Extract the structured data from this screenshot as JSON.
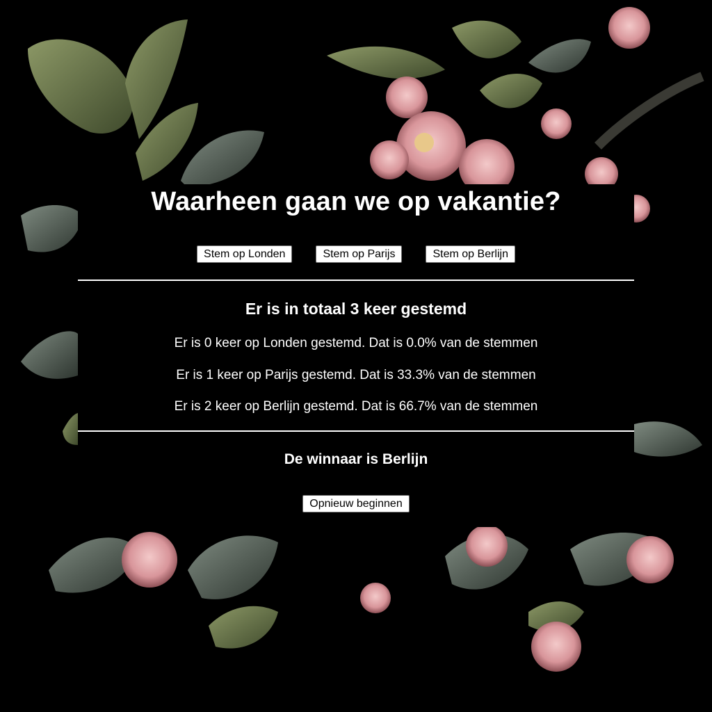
{
  "page": {
    "title": "Waarheen gaan we op vakantie?"
  },
  "votes": {
    "buttons": [
      {
        "label": "Stem op Londen"
      },
      {
        "label": "Stem op Parijs"
      },
      {
        "label": "Stem op Berlijn"
      }
    ]
  },
  "results": {
    "total_text": "Er is in totaal 3 keer gestemd",
    "lines": [
      {
        "text": "Er is 0 keer op Londen gestemd. Dat is 0.0% van de stemmen"
      },
      {
        "text": "Er is 1 keer op Parijs gestemd. Dat is 33.3% van de stemmen"
      },
      {
        "text": "Er is 2 keer op Berlijn gestemd. Dat is 66.7% van de stemmen"
      }
    ],
    "winner_text": "De winnaar is Berlijn"
  },
  "actions": {
    "restart_label": "Opnieuw beginnen"
  },
  "colors": {
    "background": "#000000",
    "text": "#ffffff",
    "leaf": "#4a5a3c",
    "leaf_light": "#7c8a5a",
    "blossom": "#e2a4a8",
    "blossom_dark": "#b87478"
  }
}
